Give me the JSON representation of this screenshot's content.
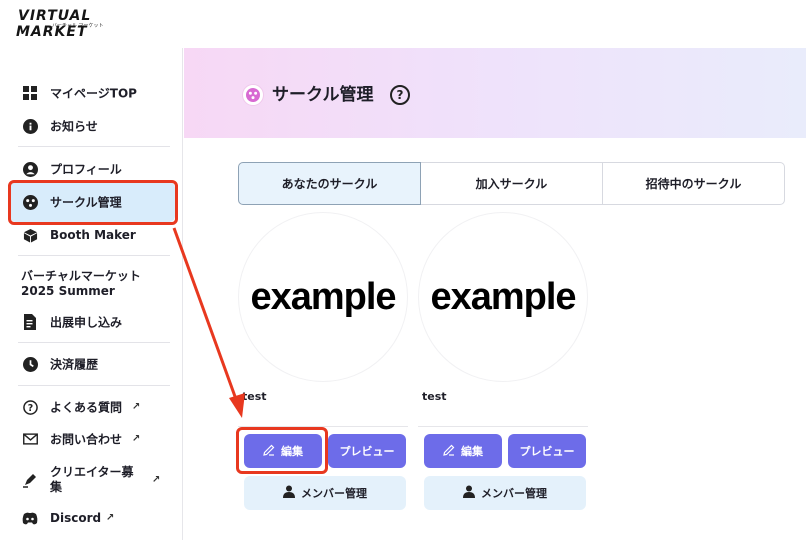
{
  "logo": {
    "line1": "VIRTUAL",
    "line2": "MARKET",
    "sub": "バーチャル マーケット"
  },
  "sidebar": {
    "items": [
      {
        "label": "マイページTOP",
        "icon": "grid-icon"
      },
      {
        "label": "お知らせ",
        "icon": "info-icon"
      },
      {
        "label": "プロフィール",
        "icon": "user-circle-icon"
      },
      {
        "label": "サークル管理",
        "icon": "circle-group-icon"
      },
      {
        "label": "Booth Maker",
        "icon": "cube-icon"
      },
      {
        "label": "出展申し込み",
        "icon": "document-edit-icon"
      },
      {
        "label": "決済履歴",
        "icon": "clock-icon"
      },
      {
        "label": "よくある質問",
        "icon": "question-icon"
      },
      {
        "label": "お問い合わせ",
        "icon": "mail-icon"
      },
      {
        "label": "クリエイター募集",
        "icon": "pen-icon"
      },
      {
        "label": "Discord",
        "icon": "discord-icon"
      }
    ],
    "event_title": "バーチャルマーケット 2025 Summer"
  },
  "header": {
    "title": "サークル管理",
    "help": "?"
  },
  "tabs": [
    {
      "label": "あなたのサークル",
      "active": true
    },
    {
      "label": "加入サークル",
      "active": false
    },
    {
      "label": "招待中のサークル",
      "active": false
    }
  ],
  "cards": [
    {
      "thumb_text": "example",
      "name": "test",
      "edit_label": "編集",
      "preview_label": "プレビュー",
      "member_label": "メンバー管理"
    },
    {
      "thumb_text": "example",
      "name": "test",
      "edit_label": "編集",
      "preview_label": "プレビュー",
      "member_label": "メンバー管理"
    }
  ],
  "colors": {
    "accent": "#6d6ce9",
    "highlight": "#e8381f",
    "active_bg": "#d8ecfb",
    "member_bg": "#e4f1fb"
  }
}
